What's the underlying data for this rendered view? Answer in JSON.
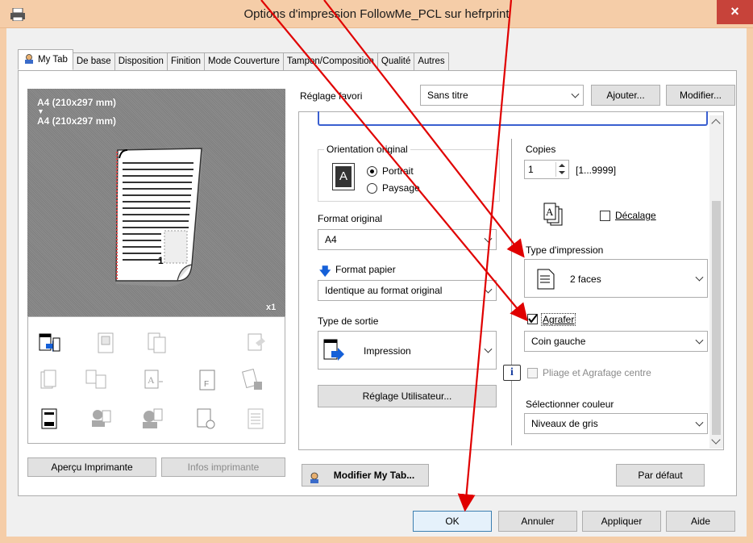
{
  "window": {
    "title": "Options d'impression FollowMe_PCL sur hefrprint",
    "close_glyph": "×"
  },
  "tabs": [
    {
      "label": "My Tab"
    },
    {
      "label": "De base"
    },
    {
      "label": "Disposition"
    },
    {
      "label": "Finition"
    },
    {
      "label": "Mode Couverture"
    },
    {
      "label": "Tampon/Composition"
    },
    {
      "label": "Qualité"
    },
    {
      "label": "Autres"
    }
  ],
  "preview": {
    "size_from": "A4 (210x297 mm)",
    "arrow": "▼",
    "size_to": "A4 (210x297 mm)",
    "page_number": "1",
    "copies_mark": "x1"
  },
  "left_buttons": {
    "apercu": "Aperçu Imprimante",
    "infos": "Infos imprimante"
  },
  "favorite": {
    "label": "Réglage favori",
    "value": "Sans titre",
    "add": "Ajouter...",
    "modify": "Modifier..."
  },
  "orientation": {
    "label": "Orientation original",
    "portrait": "Portrait",
    "paysage": "Paysage",
    "selected": "Portrait"
  },
  "format_original": {
    "label": "Format original",
    "value": "A4"
  },
  "format_papier": {
    "label": "Format papier",
    "value": "Identique au format original"
  },
  "type_sortie": {
    "label": "Type de sortie",
    "value": "Impression"
  },
  "reglage_utilisateur": "Réglage Utilisateur...",
  "copies": {
    "label": "Copies",
    "value": "1",
    "range": "[1...9999]"
  },
  "decalage": {
    "label": "Décalage",
    "checked": false
  },
  "type_impression": {
    "label": "Type d'impression",
    "value": "2 faces"
  },
  "agrafer": {
    "label": "Agrafer",
    "checked": true,
    "value": "Coin gauche"
  },
  "pliage": {
    "label": "Pliage et Agrafage centre",
    "info": "i"
  },
  "couleur": {
    "label": "Sélectionner couleur",
    "value": "Niveaux de gris"
  },
  "bottom_panel": {
    "modifier_mytab": "Modifier My Tab...",
    "par_defaut": "Par défaut"
  },
  "dialog_buttons": {
    "ok": "OK",
    "annuler": "Annuler",
    "appliquer": "Appliquer",
    "aide": "Aide"
  },
  "colors": {
    "titlebar": "#f5cda8",
    "close": "#c7433a",
    "annotation_arrow": "#e00000"
  }
}
